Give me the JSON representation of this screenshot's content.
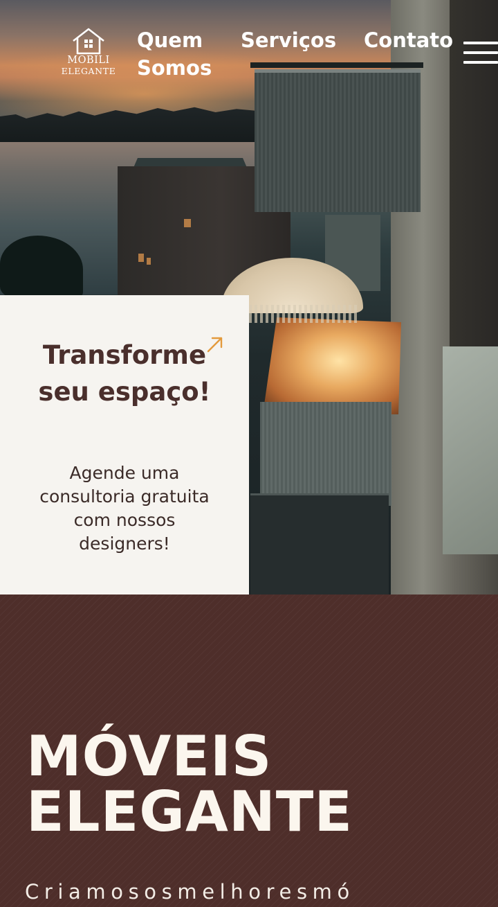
{
  "nav": {
    "logo": {
      "line1": "MOBILI",
      "line2": "ELEGANTE",
      "icon": "house-icon"
    },
    "links": [
      {
        "label": "Quem Somos"
      },
      {
        "label": "Serviços"
      },
      {
        "label": "Contato"
      }
    ],
    "menu_icon": "hamburger-menu-icon"
  },
  "hero": {
    "image_subject": "apartment balconies at dusk over a lake",
    "cta": {
      "title": "Transforme seu espaço!",
      "arrow_icon": "arrow-up-right-icon",
      "subtitle": "Agende uma consultoria gratuita com nossos designers!"
    }
  },
  "brand": {
    "title": "MÓVEIS ELEGANTE",
    "tagline": "Criamososmelhoresmó"
  },
  "colors": {
    "brand_brown": "#4e2e2a",
    "cta_background": "#f6f4f0",
    "cta_title": "#4a2f2c",
    "accent_orange": "#e39a3c",
    "text_light": "#fbf6ee"
  }
}
